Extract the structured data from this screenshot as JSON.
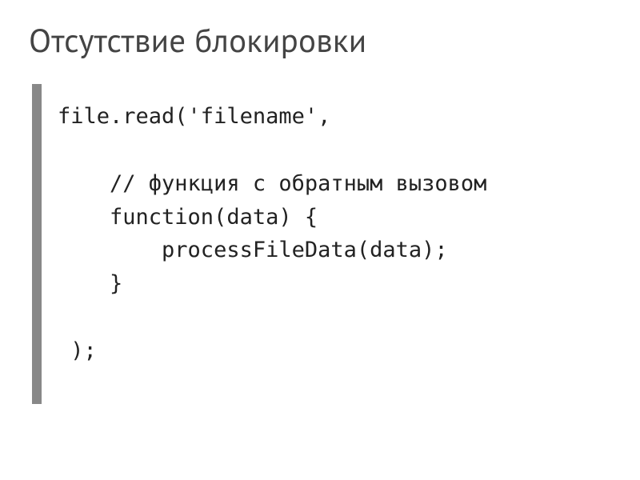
{
  "slide": {
    "title": "Отсутствие блокировки",
    "code": {
      "line1": "file.read('filename',",
      "line2": "    // функция с обратным вызовом",
      "line3": "    function(data) {",
      "line4": "        processFileData(data);",
      "line5": "    }",
      "line6": " );"
    }
  }
}
